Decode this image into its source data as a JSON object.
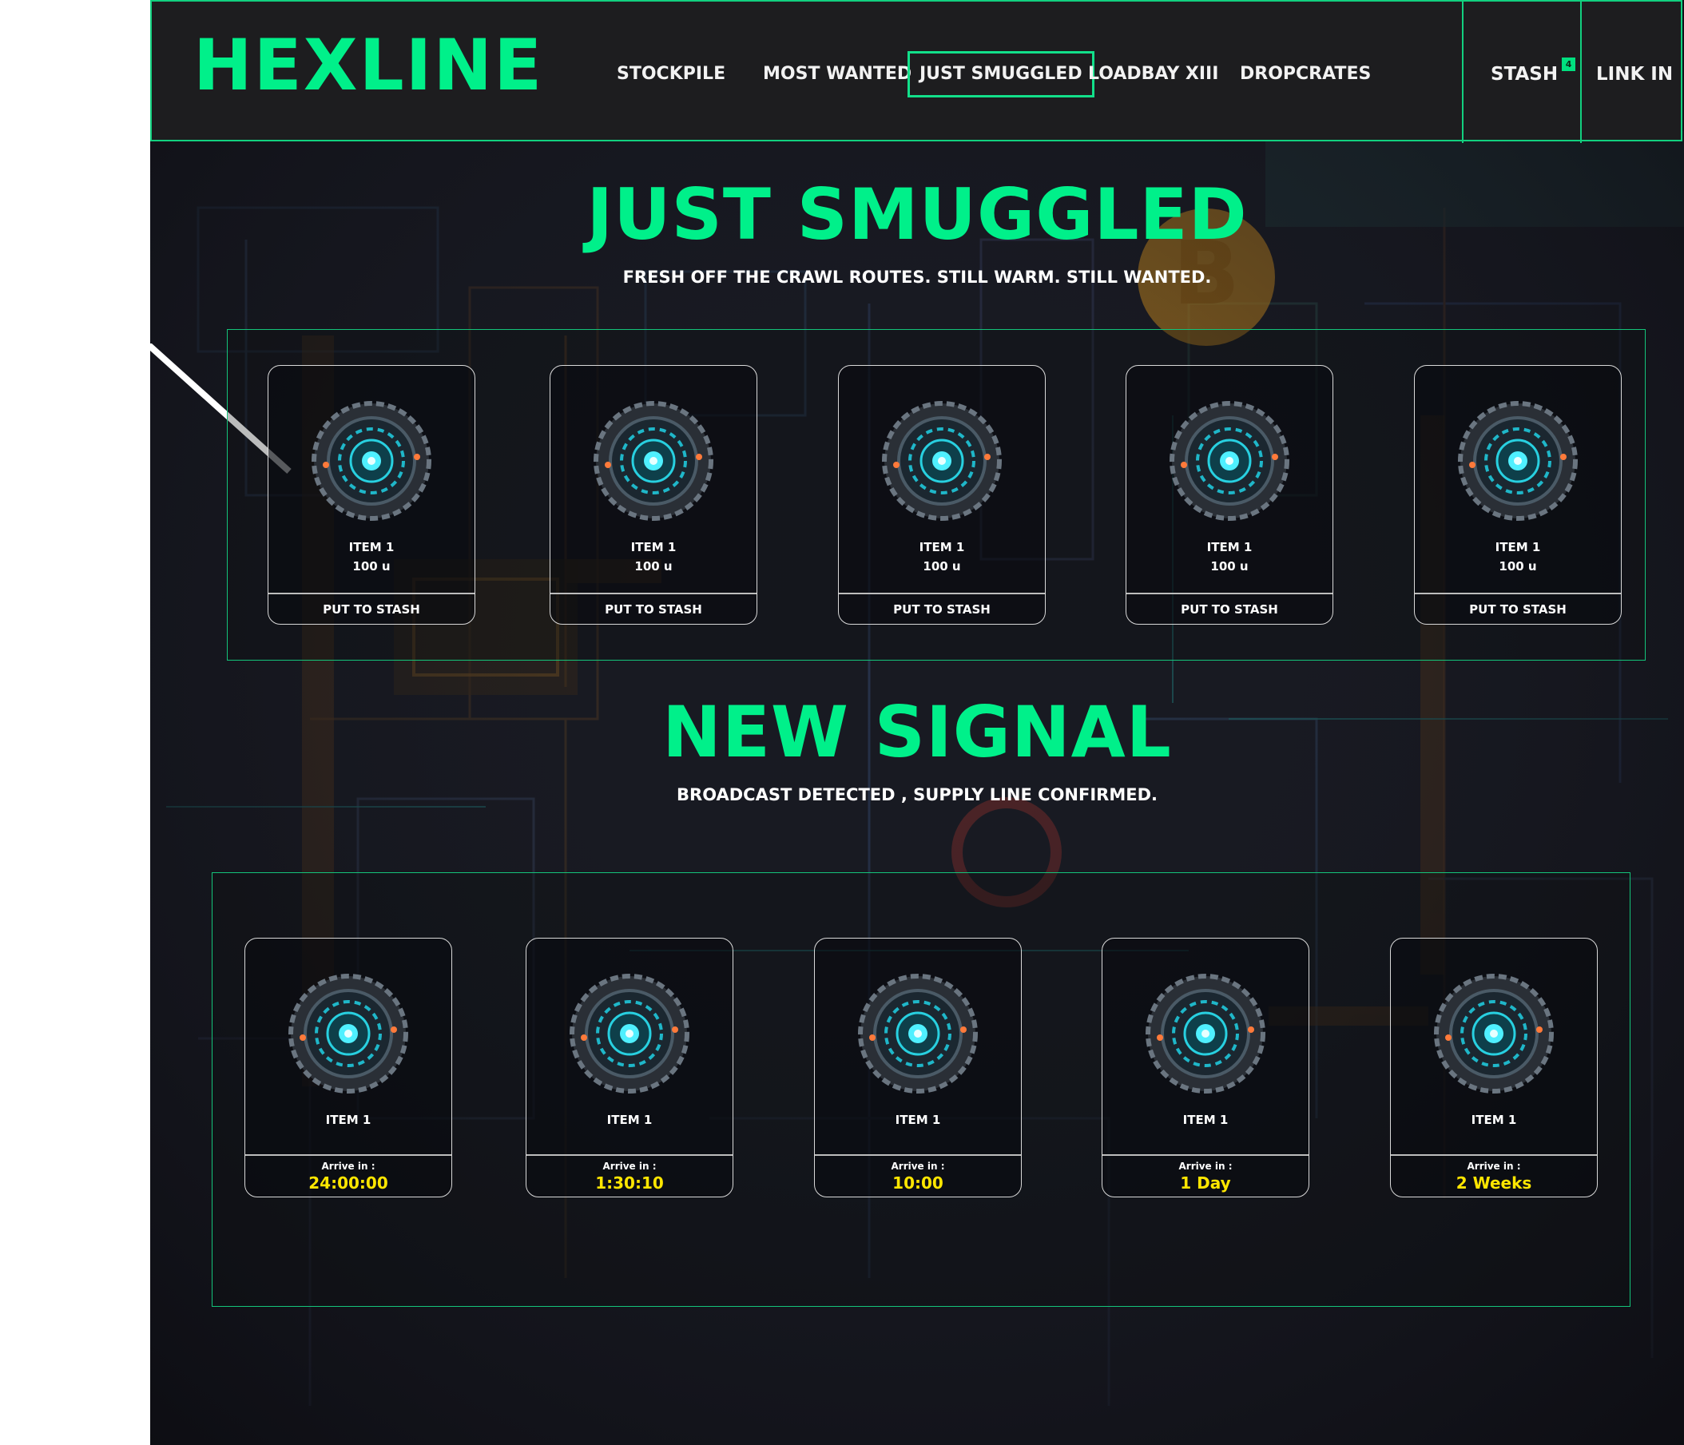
{
  "brand": {
    "name": "HEXLINE",
    "accent": "#00f08a"
  },
  "nav": {
    "items": [
      {
        "label": "STOCKPILE"
      },
      {
        "label": "MOST WANTED"
      },
      {
        "label": "JUST SMUGGLED",
        "active": true
      },
      {
        "label": "LOADBAY XIII"
      },
      {
        "label": "DROPCRATES"
      }
    ],
    "stash": {
      "label": "STASH",
      "badge_count": "4"
    },
    "link_in": {
      "label": "LINK IN"
    }
  },
  "just_smuggled": {
    "title": "JUST SMUGGLED",
    "subtitle": "FRESH OFF THE CRAWL ROUTES. STILL WARM. STILL WANTED.",
    "items": [
      {
        "name": "ITEM 1",
        "price": "100 u",
        "action": "PUT TO STASH",
        "icon": "reactor-orb-icon"
      },
      {
        "name": "ITEM 1",
        "price": "100 u",
        "action": "PUT TO STASH",
        "icon": "reactor-orb-icon"
      },
      {
        "name": "ITEM 1",
        "price": "100 u",
        "action": "PUT TO STASH",
        "icon": "reactor-orb-icon"
      },
      {
        "name": "ITEM 1",
        "price": "100 u",
        "action": "PUT TO STASH",
        "icon": "reactor-orb-icon"
      },
      {
        "name": "ITEM 1",
        "price": "100 u",
        "action": "PUT TO STASH",
        "icon": "reactor-orb-icon"
      }
    ]
  },
  "new_signal": {
    "title": "NEW SIGNAL",
    "subtitle": "BROADCAST DETECTED ,  SUPPLY LINE CONFIRMED.",
    "items": [
      {
        "name": "ITEM 1",
        "arrive_label": "Arrive in :",
        "arrive_value": "24:00:00",
        "icon": "reactor-orb-icon"
      },
      {
        "name": "ITEM 1",
        "arrive_label": "Arrive in :",
        "arrive_value": "1:30:10",
        "icon": "reactor-orb-icon"
      },
      {
        "name": "ITEM 1",
        "arrive_label": "Arrive in :",
        "arrive_value": "10:00",
        "icon": "reactor-orb-icon"
      },
      {
        "name": "ITEM 1",
        "arrive_label": "Arrive in :",
        "arrive_value": "1 Day",
        "icon": "reactor-orb-icon"
      },
      {
        "name": "ITEM 1",
        "arrive_label": "Arrive in :",
        "arrive_value": "2 Weeks",
        "icon": "reactor-orb-icon"
      }
    ]
  },
  "colors": {
    "background": "#15161c",
    "header_bg": "#1d1d1f",
    "accent_green": "#00f08a",
    "timer_yellow": "#ffe600",
    "coin_gold": "#c98a1c"
  }
}
